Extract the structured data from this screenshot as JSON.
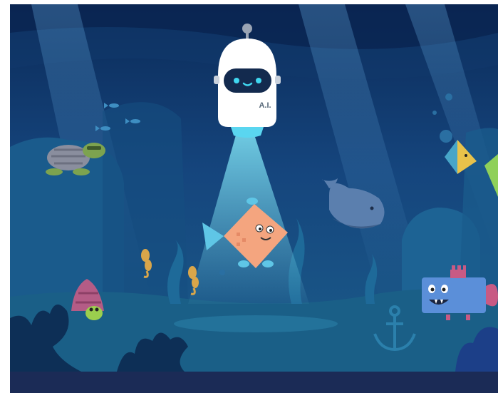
{
  "robot": {
    "label": "A.I.",
    "face_icon": "robot-face-icon"
  },
  "creatures": [
    "turtle",
    "whale",
    "pufferfish-diamond",
    "seahorse",
    "seahorse",
    "hermit-crab",
    "angelfish",
    "angelfish",
    "box-monster-fish",
    "small-fish-school"
  ],
  "colors": {
    "water_top": "#0c2d5b",
    "water_mid": "#164d83",
    "seafloor": "#1a5f87",
    "beam": "#6fd3ea",
    "robot_body": "#ffffff",
    "robot_eyes": "#40d7f0",
    "fish_body": "#f4a57f",
    "bottom_bar": "#1b2b56"
  }
}
